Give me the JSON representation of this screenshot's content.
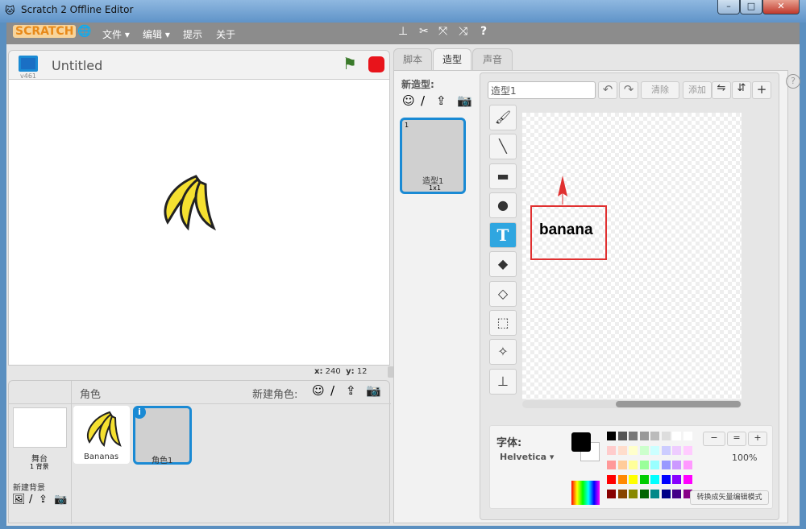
{
  "window": {
    "title": "Scratch 2 Offline Editor",
    "minimize": "–",
    "maximize": "□",
    "close": "✕"
  },
  "menu": {
    "logo": "SCRATCH",
    "file": "文件 ▾",
    "edit": "编辑 ▾",
    "tips": "提示",
    "about": "关于"
  },
  "stage": {
    "title": "Untitled",
    "version": "v461",
    "x_label": "x:",
    "x_value": "240",
    "y_label": "y:",
    "y_value": "12"
  },
  "tabs": [
    {
      "label": "脚本"
    },
    {
      "label": "造型"
    },
    {
      "label": "声音"
    }
  ],
  "costumes": {
    "new_label": "新造型:",
    "items": [
      {
        "index": "1",
        "name": "造型1",
        "size": "1x1"
      }
    ]
  },
  "editor": {
    "costume_name": "造型1",
    "clear": "清除",
    "add": "添加",
    "canvas_text": "banana",
    "font_label": "字体:",
    "font_value": "Helvetica ▾",
    "zoom": "100%",
    "mode_button": "转换成矢量编辑模式"
  },
  "sprites": {
    "header": "角色",
    "new_sprite": "新建角色:",
    "stage_label": "舞台",
    "stage_backdrops": "1 背景",
    "new_backdrop": "新建背景",
    "items": [
      {
        "name": "Bananas"
      },
      {
        "name": "角色1"
      }
    ]
  },
  "colors": {
    "accent": "#1a8ad4",
    "annotation": "#e03030",
    "menubar": "#8c8c8c"
  }
}
